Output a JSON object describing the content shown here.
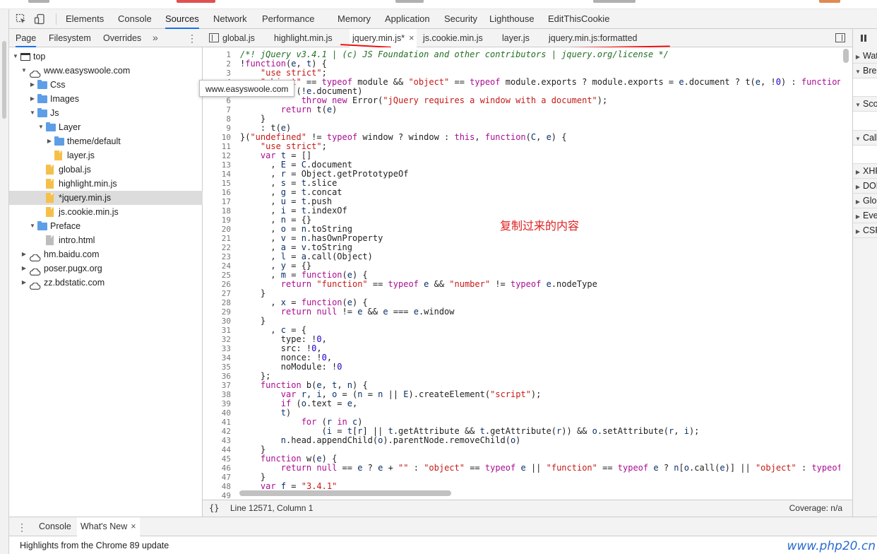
{
  "toolbar": {
    "tabs": [
      "Elements",
      "Console",
      "Sources",
      "Network",
      "Performance",
      "Memory",
      "Application",
      "Security",
      "Lighthouse",
      "EditThisCookie"
    ],
    "active_tab": "Sources"
  },
  "navigator": {
    "tabs": [
      "Page",
      "Filesystem",
      "Overrides"
    ],
    "more": "»",
    "tree": [
      {
        "label": "top",
        "level": 0,
        "icon": "frame",
        "expanded": true
      },
      {
        "label": "www.easyswoole.com",
        "level": 1,
        "icon": "cloud",
        "expanded": true
      },
      {
        "label": "Css",
        "level": 2,
        "icon": "folder",
        "expanded": false
      },
      {
        "label": "Images",
        "level": 2,
        "icon": "folder",
        "expanded": false
      },
      {
        "label": "Js",
        "level": 2,
        "icon": "folder",
        "expanded": true
      },
      {
        "label": "Layer",
        "level": 3,
        "icon": "folder",
        "expanded": true
      },
      {
        "label": "theme/default",
        "level": 4,
        "icon": "folder",
        "expanded": false
      },
      {
        "label": "layer.js",
        "level": 4,
        "icon": "file"
      },
      {
        "label": "global.js",
        "level": 3,
        "icon": "file"
      },
      {
        "label": "highlight.min.js",
        "level": 3,
        "icon": "file"
      },
      {
        "label": "*jquery.min.js",
        "level": 3,
        "icon": "file",
        "selected": true
      },
      {
        "label": "js.cookie.min.js",
        "level": 3,
        "icon": "file"
      },
      {
        "label": "Preface",
        "level": 2,
        "icon": "folder",
        "expanded": true
      },
      {
        "label": "intro.html",
        "level": 3,
        "icon": "html"
      },
      {
        "label": "hm.baidu.com",
        "level": 1,
        "icon": "cloud",
        "expanded": false
      },
      {
        "label": "poser.pugx.org",
        "level": 1,
        "icon": "cloud",
        "expanded": false
      },
      {
        "label": "zz.bdstatic.com",
        "level": 1,
        "icon": "cloud",
        "expanded": false
      }
    ],
    "tooltip": "www.easyswoole.com"
  },
  "editor": {
    "tabs": [
      {
        "label": "global.js",
        "closable": false
      },
      {
        "label": "highlight.min.js",
        "closable": false
      },
      {
        "label": "jquery.min.js*",
        "closable": true,
        "active": true
      },
      {
        "label": "js.cookie.min.js",
        "closable": false
      },
      {
        "label": "layer.js",
        "closable": false
      },
      {
        "label": "jquery.min.js:formatted",
        "closable": false
      }
    ],
    "close_glyph": "×",
    "annotation": "复制过来的内容",
    "status": {
      "braces": "{}",
      "position": "Line 12571, Column 1",
      "coverage": "Coverage: n/a"
    }
  },
  "right_panel": {
    "sections": [
      "Watch",
      "Breakpoints",
      "Scope",
      "Call Stack",
      "XHR/fetch Breakpoints",
      "DOM Breakpoints",
      "Global Listeners",
      "Event Listener Breakpoints",
      "CSP Violation Breakpoints"
    ]
  },
  "drawer": {
    "tabs": [
      {
        "label": "Console",
        "closable": false
      },
      {
        "label": "What's New",
        "closable": true,
        "active": true
      }
    ],
    "message": "Highlights from the Chrome 89 update",
    "watermark": "www.php20.cn"
  },
  "colors": {
    "accent": "#1a73e8",
    "annotation": "#e02020",
    "watermark": "#2b6cd0"
  }
}
